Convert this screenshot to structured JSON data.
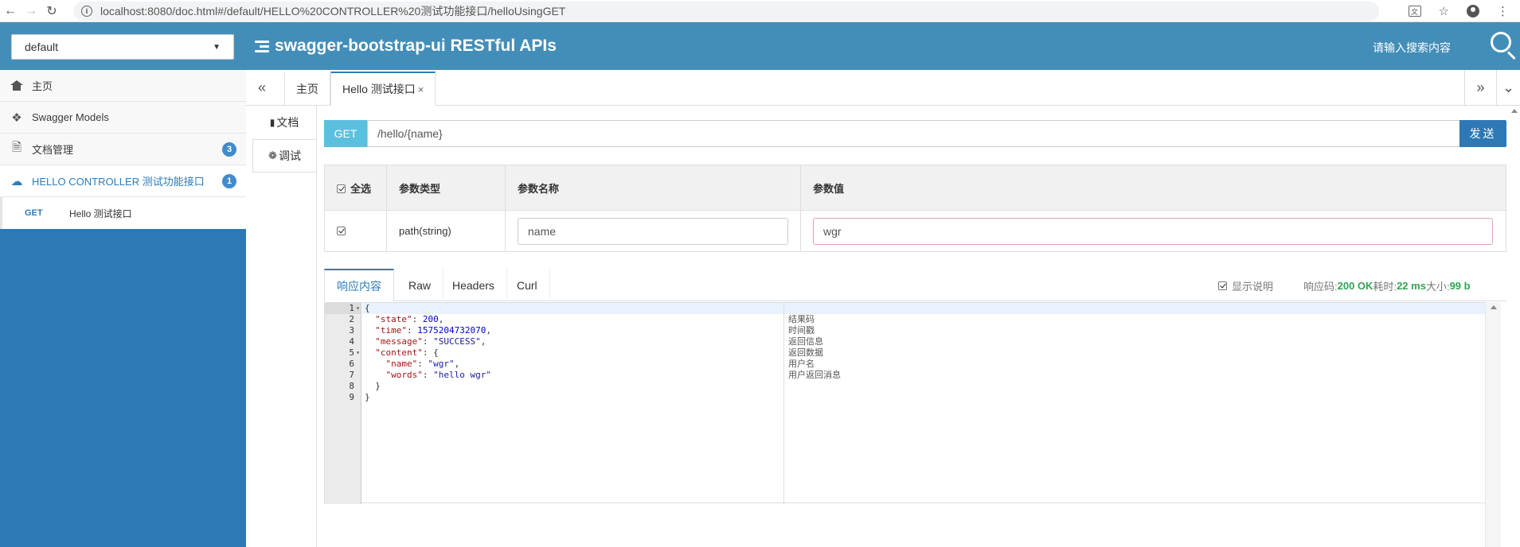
{
  "browser": {
    "url": "localhost:8080/doc.html#/default/HELLO%20CONTROLLER%20测试功能接口/helloUsingGET",
    "info_glyph": "i"
  },
  "header": {
    "group_select": "default",
    "app_title": "swagger-bootstrap-ui RESTful APIs",
    "search_placeholder": "请输入搜索内容",
    "bg_color": "#438eb9"
  },
  "sidebar": {
    "items": [
      {
        "label": "主页",
        "icon": "home-icon"
      },
      {
        "label": "Swagger Models",
        "icon": "cubes-icon"
      },
      {
        "label": "文档管理",
        "icon": "file-gear-icon",
        "badge": "3"
      },
      {
        "label": "HELLO CONTROLLER 测试功能接口",
        "icon": "cloud-icon",
        "badge": "1"
      }
    ],
    "sub_items": [
      {
        "method": "GET",
        "label": "Hello 测试接口"
      }
    ]
  },
  "tabs": {
    "items": [
      {
        "label": "主页"
      },
      {
        "label": "Hello 测试接口",
        "close": "×"
      }
    ]
  },
  "doc_tabs": {
    "doc": "文档",
    "debug": "调试"
  },
  "request": {
    "method": "GET",
    "path": "/hello/{name}",
    "send_label": "发送"
  },
  "params": {
    "headers": [
      "全选",
      "参数类型",
      "参数名称",
      "参数值"
    ],
    "rows": [
      {
        "type": "path(string)",
        "name": "name",
        "value": "wgr"
      }
    ]
  },
  "response": {
    "tabs": [
      "响应内容",
      "Raw",
      "Headers",
      "Curl"
    ],
    "show_desc_label": "显示说明",
    "code_label": "响应码:",
    "code_value": "200 OK",
    "time_label": "耗时:",
    "time_value": "22 ms",
    "size_label": "大小:",
    "size_value": "99 b",
    "line_numbers": [
      "1",
      "2",
      "3",
      "4",
      "5",
      "6",
      "7",
      "8",
      "9"
    ],
    "descriptions": [
      "结果码",
      "时间戳",
      "返回信息",
      "返回数据",
      "用户名",
      "用户返回消息"
    ]
  }
}
